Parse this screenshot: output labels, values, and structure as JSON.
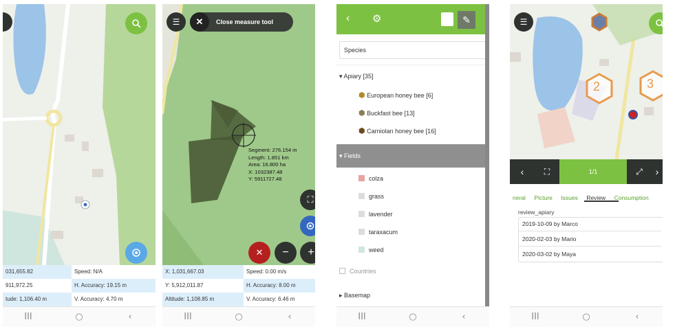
{
  "colors": {
    "accent_green": "#7dc142",
    "map_green": "#a9cf8a",
    "water": "#9cc3e8",
    "dark_button": "#2f3330",
    "close_red": "#b61f1f",
    "selected_blue": "#ddeefb"
  },
  "screen1": {
    "info": {
      "x": "031,655.82",
      "y": "911,972.25",
      "alt": "tude: 1,106.40 m",
      "speed": "Speed: N/A",
      "h_acc": "H. Accuracy: 19.15 m",
      "v_acc": "V. Accuracy: 4.70 m"
    },
    "icons": {
      "search": "search-icon",
      "locate": "locate-icon"
    }
  },
  "screen2": {
    "close_tool_label": "Close measure tool",
    "measure": {
      "segment": "Segment: 276.154 m",
      "length": "Length: 1.851 km",
      "area": "Area: 16.800 ha",
      "x": "X: 1032387.48",
      "y": "Y: 5911727.48"
    },
    "info": {
      "x": "X: 1,031,667.03",
      "y": "Y: 5,912,011.87",
      "alt": "Altitude: 1,108.85 m",
      "speed": "Speed: 0.00 m/s",
      "h_acc": "H. Accuracy: 8.00 m",
      "v_acc": "V. Accuracy: 6.46 m"
    }
  },
  "screen3": {
    "dropdown": "Species",
    "groups": [
      {
        "label": "Apiary [35]",
        "items": [
          {
            "label": "European honey bee [6]",
            "color": "#b08a2a"
          },
          {
            "label": "Buckfast bee [13]",
            "color": "#8a7a55"
          },
          {
            "label": "Carniolan honey bee [16]",
            "color": "#6b4a1f"
          }
        ]
      },
      {
        "label": "Fields",
        "items": [
          {
            "label": "colza",
            "color": "#e8a3a3"
          },
          {
            "label": "grass",
            "color": "#dcdcdc"
          },
          {
            "label": "lavender",
            "color": "#dcdcdc"
          },
          {
            "label": "taraxacum",
            "color": "#dcdcdc"
          },
          {
            "label": "weed",
            "color": "#cfe6de"
          }
        ]
      },
      {
        "label": "Countries",
        "items": []
      },
      {
        "label": "Basemap",
        "items": []
      }
    ]
  },
  "screen4": {
    "pager": "1/1",
    "hex_labels": [
      "2",
      "3"
    ],
    "tabs": [
      "neral",
      "Picture",
      "Issues",
      "Review",
      "Consumption"
    ],
    "active_tab": "Review",
    "field_label": "review_apiary",
    "reviews": [
      "2019-10-09 by Marco",
      "2020-02-03 by Mario",
      "2020-03-02 by Maya"
    ]
  },
  "navbar": {
    "recent": "III",
    "home": "○",
    "back": "‹"
  }
}
